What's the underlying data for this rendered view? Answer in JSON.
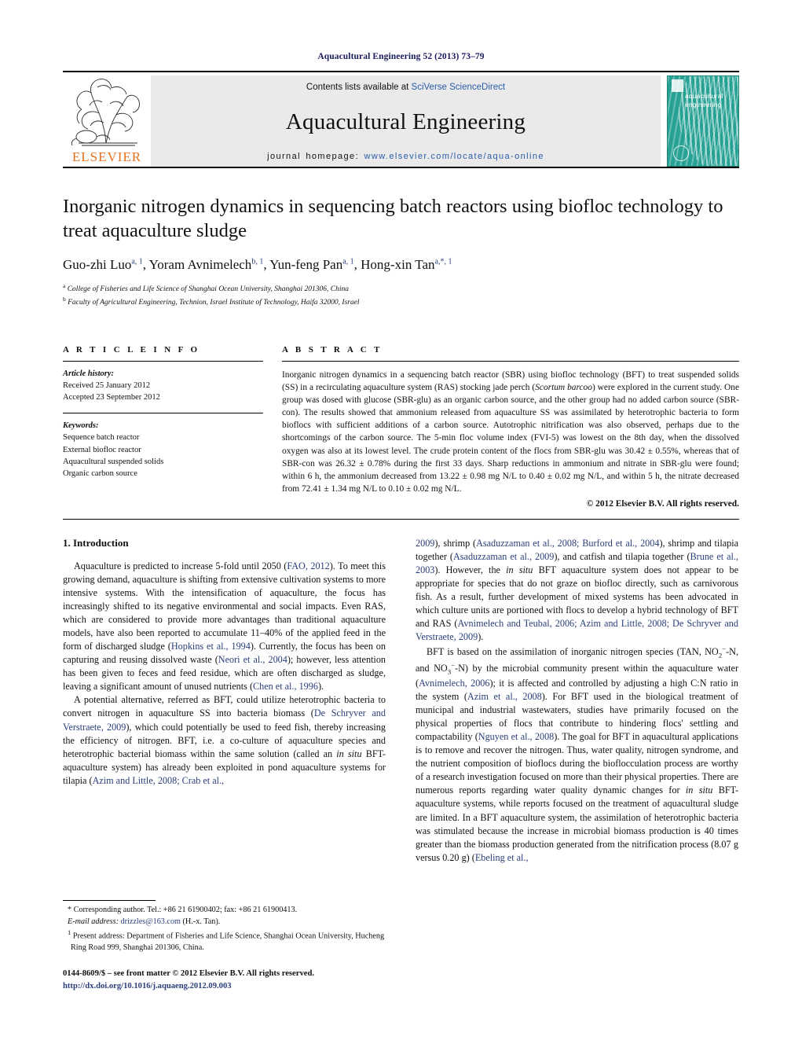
{
  "running_head": "Aquacultural Engineering 52 (2013) 73–79",
  "masthead": {
    "publisher_name": "ELSEVIER",
    "contents_prefix": "Contents lists available at ",
    "contents_link": "SciVerse ScienceDirect",
    "journal_title": "Aquacultural Engineering",
    "homepage_label": "journal homepage: ",
    "homepage_url": "www.elsevier.com/locate/aqua-online",
    "cover_title_line1": "aquacultural",
    "cover_title_line2": "engineering",
    "cover_color": "#27a193"
  },
  "article": {
    "title": "Inorganic nitrogen dynamics in sequencing batch reactors using biofloc technology to treat aquaculture sludge",
    "authors_html": "Guo-zhi Luo<sup>a, 1</sup>, Yoram Avnimelech<sup>b, 1</sup>, Yun-feng Pan<sup>a, 1</sup>, Hong-xin Tan<sup>a,*, 1</sup>",
    "affiliation_a": "College of Fisheries and Life Science of Shanghai Ocean University, Shanghai 201306, China",
    "affiliation_b": "Faculty of Agricultural Engineering, Technion, Israel Institute of Technology, Haifa 32000, Israel"
  },
  "info": {
    "heading": "A R T I C L E   I N F O",
    "history_label": "Article history:",
    "received": "Received 25 January 2012",
    "accepted": "Accepted 23 September 2012",
    "keywords_label": "Keywords:",
    "keywords": [
      "Sequence batch reactor",
      "External biofloc reactor",
      "Aquacultural suspended solids",
      "Organic carbon source"
    ]
  },
  "abstract": {
    "heading": "A B S T R A C T",
    "text_html": "Inorganic nitrogen dynamics in a sequencing batch reactor (SBR) using biofloc technology (BFT) to treat suspended solids (SS) in a recirculating aquaculture system (RAS) stocking jade perch (<i>Scortum barcoo</i>) were explored in the current study. One group was dosed with glucose (SBR-glu) as an organic carbon source, and the other group had no added carbon source (SBR-con). The results showed that ammonium released from aquaculture SS was assimilated by heterotrophic bacteria to form bioflocs with sufficient additions of a carbon source. Autotrophic nitrification was also observed, perhaps due to the shortcomings of the carbon source. The 5-min floc volume index (FVI-5) was lowest on the 8th day, when the dissolved oxygen was also at its lowest level. The crude protein content of the flocs from SBR-glu was 30.42 ± 0.55%, whereas that of SBR-con was 26.32 ± 0.78% during the first 33 days. Sharp reductions in ammonium and nitrate in SBR-glu were found; within 6 h, the ammonium decreased from 13.22 ± 0.98 mg N/L to 0.40 ± 0.02 mg N/L, and within 5 h, the nitrate decreased from 72.41 ± 1.34 mg N/L to 0.10 ± 0.02 mg N/L.",
    "copyright": "© 2012 Elsevier B.V. All rights reserved."
  },
  "introduction": {
    "heading": "1.  Introduction",
    "left_paragraphs_html": [
      "Aquaculture is predicted to increase 5-fold until 2050 (<span class=\"cite\">FAO, 2012</span>). To meet this growing demand, aquaculture is shifting from extensive cultivation systems to more intensive systems. With the intensification of aquaculture, the focus has increasingly shifted to its negative environmental and social impacts. Even RAS, which are considered to provide more advantages than traditional aquaculture models, have also been reported to accumulate 11–40% of the applied feed in the form of discharged sludge (<span class=\"cite\">Hopkins et al., 1994</span>). Currently, the focus has been on capturing and reusing dissolved waste (<span class=\"cite\">Neori et al., 2004</span>); however, less attention has been given to feces and feed residue, which are often discharged as sludge, leaving a significant amount of unused nutrients (<span class=\"cite\">Chen et al., 1996</span>).",
      "A potential alternative, referred as BFT, could utilize heterotrophic bacteria to convert nitrogen in aquaculture SS into bacteria biomass (<span class=\"cite\">De Schryver and Verstraete, 2009</span>), which could potentially be used to feed fish, thereby increasing the efficiency of nitrogen. BFT, i.e. a co-culture of aquaculture species and heterotrophic bacterial biomass within the same solution (called an <span class=\"ital\">in situ</span> BFT-aquaculture system) has already been exploited in pond aquaculture systems for tilapia (<span class=\"cite\">Azim and Little, 2008; Crab et al.,</span>"
    ],
    "right_paragraphs_html": [
      "<span class=\"cite\">2009</span>), shrimp (<span class=\"cite\">Asaduzzaman et al., 2008; Burford et al., 2004</span>), shrimp and tilapia together (<span class=\"cite\">Asaduzzaman et al., 2009</span>), and catfish and tilapia together (<span class=\"cite\">Brune et al., 2003</span>). However, the <span class=\"ital\">in situ</span> BFT aquaculture system does not appear to be appropriate for species that do not graze on biofloc directly, such as carnivorous fish. As a result, further development of mixed systems has been advocated in which culture units are portioned with flocs to develop a hybrid technology of BFT and RAS (<span class=\"cite\">Avnimelech and Teubal, 2006; Azim and Little, 2008; De Schryver and Verstraete, 2009</span>).",
      "BFT is based on the assimilation of inorganic nitrogen species (TAN, NO<sub>2</sub><sup class=\"chg\">−</sup>-N, and NO<sub>3</sub><sup class=\"chg\">−</sup>-N) by the microbial community present within the aquaculture water (<span class=\"cite\">Avnimelech, 2006</span>); it is affected and controlled by adjusting a high C:N ratio in the system (<span class=\"cite\">Azim et al., 2008</span>). For BFT used in the biological treatment of municipal and industrial wastewaters, studies have primarily focused on the physical properties of flocs that contribute to hindering flocs' settling and compactability (<span class=\"cite\">Nguyen et al., 2008</span>). The goal for BFT in aquacultural applications is to remove and recover the nitrogen. Thus, water quality, nitrogen syndrome, and the nutrient composition of bioflocs during the bioflocculation process are worthy of a research investigation focused on more than their physical properties. There are numerous reports regarding water quality dynamic changes for <span class=\"ital\">in situ</span> BFT-aquaculture systems, while reports focused on the treatment of aquacultural sludge are limited. In a BFT aquaculture system, the assimilation of heterotrophic bacteria was stimulated because the increase in microbial biomass production is 40 times greater than the biomass production generated from the nitrification process (8.07 g versus 0.20 g) (<span class=\"cite\">Ebeling et al.,</span>"
    ]
  },
  "footnotes": {
    "corresponding_html": "* Corresponding author. Tel.: +86 21 61900402; fax: +86 21 61900413.",
    "email_label": "E-mail address:",
    "email": "drizzles@163.com",
    "email_suffix": "(H.-x. Tan).",
    "present_address_html": "<sup>1</sup>  Present address: Department of Fisheries and Life Science, Shanghai Ocean University, Hucheng Ring Road 999, Shanghai 201306, China."
  },
  "imprint": {
    "line1": "0144-8609/$ – see front matter © 2012 Elsevier B.V. All rights reserved.",
    "doi": "http://dx.doi.org/10.1016/j.aquaeng.2012.09.003"
  }
}
